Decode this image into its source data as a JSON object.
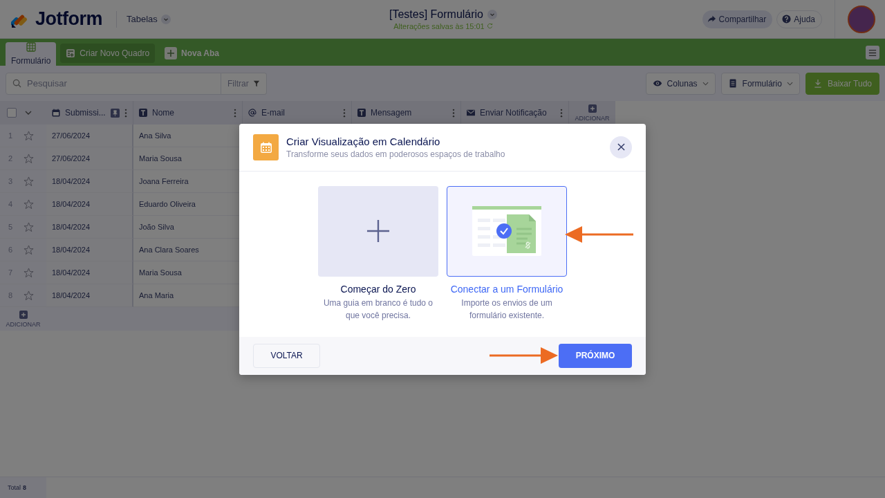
{
  "header": {
    "logo": "Jotform",
    "nav": "Tabelas",
    "title": "[Testes] Formulário",
    "save_status": "Alterações salvas às 15:01",
    "buttons": [
      {
        "label": "Compartilhar",
        "kind": "share"
      },
      {
        "label": "Ajuda",
        "kind": "help"
      }
    ]
  },
  "tabs": [
    {
      "label": "Formulário",
      "kind": "table",
      "selected": true
    },
    {
      "label": "Criar Novo Quadro",
      "kind": "create",
      "selected": false
    },
    {
      "label": "Nova Aba",
      "kind": "add",
      "selected": false
    }
  ],
  "toolbar": {
    "search": {
      "placeholder": "Pesquisar"
    },
    "filter": "Filtrar",
    "buttons": [
      {
        "label": "Colunas",
        "kind": "columns"
      },
      {
        "label": "Formulário",
        "kind": "form"
      },
      {
        "label": "Baixar Tudo",
        "kind": "download"
      }
    ]
  },
  "table": {
    "select_all": {
      "checked": false
    },
    "columns": [
      {
        "label": "Submissi...",
        "kind": "date",
        "pinned": true
      },
      {
        "label": "Nome",
        "kind": "text",
        "pinned": false
      },
      {
        "label": "E-mail",
        "kind": "email",
        "pinned": false
      },
      {
        "label": "Mensagem",
        "kind": "text",
        "pinned": false
      },
      {
        "label": "Enviar Notificação",
        "kind": "mail",
        "pinned": false
      }
    ],
    "add_column": "ADICIONAR",
    "rows": [
      {
        "number": "1",
        "date": "27/06/2024",
        "name": "Ana Silva"
      },
      {
        "number": "2",
        "date": "27/06/2024",
        "name": "Maria Sousa"
      },
      {
        "number": "3",
        "date": "18/04/2024",
        "name": "Joana Ferreira"
      },
      {
        "number": "4",
        "date": "18/04/2024",
        "name": "Eduardo Oliveira"
      },
      {
        "number": "5",
        "date": "18/04/2024",
        "name": "João Silva"
      },
      {
        "number": "6",
        "date": "18/04/2024",
        "name": "Ana Clara Soares"
      },
      {
        "number": "7",
        "date": "18/04/2024",
        "name": "Maria Sousa"
      },
      {
        "number": "8",
        "date": "18/04/2024",
        "name": "Ana Maria"
      }
    ],
    "add_row": "ADICIONAR"
  },
  "status_bar": "Total **8**",
  "modal": {
    "title": "Criar Visualização em Calendário",
    "subtitle": "Transforme seus dados em poderosos espaços de trabalho",
    "options": [
      {
        "kind": "blank",
        "title": "Começar do Zero",
        "description": "Uma guia em branco é tudo o que você precisa.",
        "selected": false
      },
      {
        "kind": "form",
        "title": "Conectar a um Formulário",
        "description": "Importe os envios de um formulário existente.",
        "selected": true
      }
    ],
    "back": "VOLTAR",
    "next": "PRÓXIMO"
  }
}
